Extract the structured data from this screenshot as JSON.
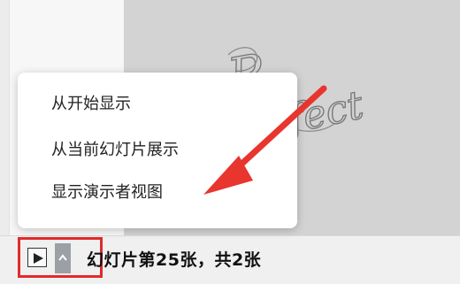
{
  "menu": {
    "items": [
      {
        "label": "从开始显示"
      },
      {
        "label": "从当前幻灯片展示"
      },
      {
        "label": "显示演示者视图"
      }
    ]
  },
  "status_bar": {
    "slide_info": "幻灯片第25张，共2张"
  },
  "slide": {
    "decorative_text": "Perfect"
  },
  "colors": {
    "highlight": "#e02b2b",
    "arrow": "#e8352e",
    "slide_bg": "#d3d3d3"
  }
}
